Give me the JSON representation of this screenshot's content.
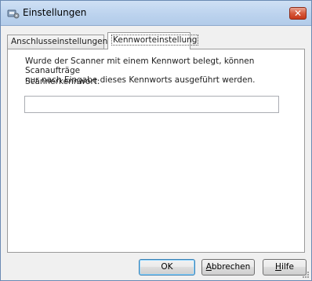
{
  "window": {
    "title": "Einstellungen",
    "close_glyph": "✕"
  },
  "tabs": [
    {
      "label": "Anschlusseinstellungen",
      "selected": false
    },
    {
      "label": "Kennworteinstellung",
      "selected": true
    }
  ],
  "panel": {
    "description_line1": "Wurde der Scanner mit einem Kennwort belegt, können Scanaufträge",
    "description_line2": "nur nach Eingabe dieses Kennworts ausgeführt werden.",
    "password_label": "Scannerkennwort:",
    "password_value": ""
  },
  "buttons": {
    "ok": "OK",
    "cancel_mnemonic": "A",
    "cancel_rest": "bbrechen",
    "help_mnemonic": "H",
    "help_rest": "ilfe"
  },
  "colors": {
    "accent": "#3c7fb1",
    "close_red": "#c7381a"
  },
  "icons": {
    "app": "scanner-settings-icon",
    "close": "close-icon",
    "resize": "resize-grip-icon"
  }
}
